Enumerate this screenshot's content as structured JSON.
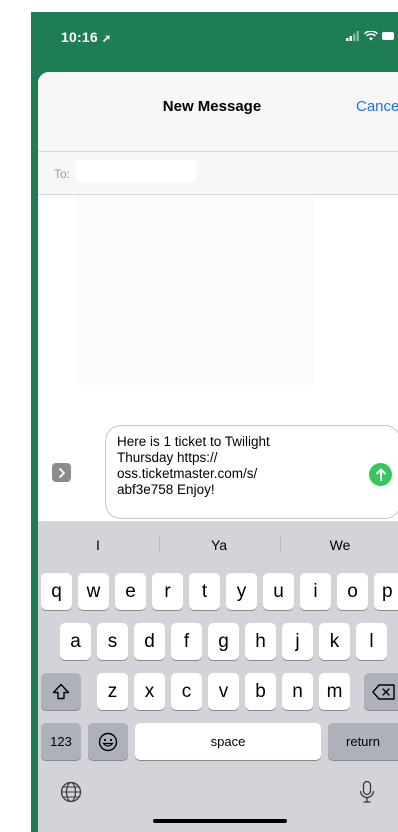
{
  "status_bar": {
    "time": "10:16"
  },
  "nav": {
    "title": "New Message",
    "cancel": "Cancel"
  },
  "recipients": {
    "to_label": "To:",
    "value": ""
  },
  "composer": {
    "message_line1": "Here is 1 ticket to Twilight",
    "message_line2": "Thursday https://",
    "message_line3": "oss.ticketmaster.com/s/",
    "message_line4": "abf3e758 Enjoy!"
  },
  "keyboard": {
    "suggestions": [
      "I",
      "Ya",
      "We"
    ],
    "row1": [
      "q",
      "w",
      "e",
      "r",
      "t",
      "y",
      "u",
      "i",
      "o",
      "p"
    ],
    "row2": [
      "a",
      "s",
      "d",
      "f",
      "g",
      "h",
      "j",
      "k",
      "l"
    ],
    "row3": [
      "z",
      "x",
      "c",
      "v",
      "b",
      "n",
      "m"
    ],
    "numbers_key": "123",
    "space_key": "space",
    "return_key": "return"
  },
  "colors": {
    "background": "#1e7d55",
    "accent": "#1a73e8",
    "send": "#34c759"
  }
}
